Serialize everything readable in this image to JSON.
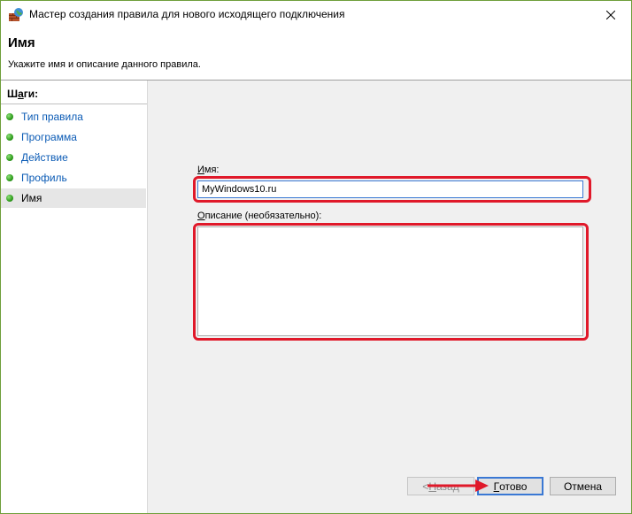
{
  "window": {
    "title": "Мастер создания правила для нового исходящего подключения",
    "close_label": "✕"
  },
  "header": {
    "title": "Имя",
    "subtitle": "Укажите имя и описание данного правила."
  },
  "sidebar": {
    "title_prefix": "Ш",
    "title_accel": "а",
    "title_suffix": "ги:",
    "items": [
      {
        "label": "Тип правила"
      },
      {
        "label": "Программа"
      },
      {
        "label": "Действие"
      },
      {
        "label": "Профиль"
      },
      {
        "label": "Имя"
      }
    ],
    "active_index": 4
  },
  "form": {
    "name_label_accel": "И",
    "name_label_rest": "мя:",
    "name_value": "MyWindows10.ru",
    "desc_label_accel": "О",
    "desc_label_rest": "писание (необязательно):",
    "desc_value": ""
  },
  "buttons": {
    "back_prefix": "< ",
    "back_accel": "Н",
    "back_rest": "азад",
    "finish_accel": "Г",
    "finish_rest": "отово",
    "cancel_label": "Отмена"
  },
  "colors": {
    "highlight": "#e0192a",
    "link": "#0b5bb5",
    "step_dot": "#2e9c1c",
    "focus_border": "#3a78d4"
  },
  "icons": {
    "title": "firewall-globe-icon",
    "close": "close-icon",
    "step": "green-dot-icon"
  }
}
